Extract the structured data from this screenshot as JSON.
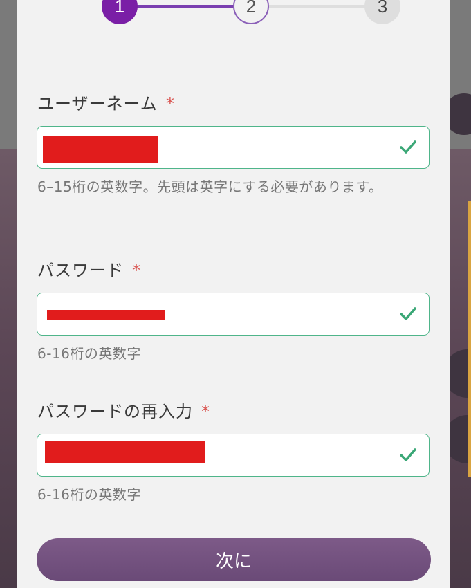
{
  "stepper": {
    "steps": [
      "1",
      "2",
      "3"
    ],
    "current": 1
  },
  "form": {
    "username": {
      "label": "ユーザーネーム",
      "required_mark": "*",
      "hint": "6–15桁の英数字。先頭は英字にする必要があります。",
      "status": "valid"
    },
    "password": {
      "label": "パスワード",
      "required_mark": "*",
      "hint": "6-16桁の英数字",
      "status": "valid"
    },
    "password_confirm": {
      "label": "パスワードの再入力",
      "required_mark": "*",
      "hint": "6-16桁の英数字",
      "status": "valid"
    },
    "next_label": "次に"
  },
  "colors": {
    "accent": "#7a1fa6",
    "valid": "#3aa776",
    "required": "#d9534f",
    "button": "#6e4d7a",
    "redaction": "#e11c1c"
  },
  "icons": {
    "field_status": "check-icon"
  }
}
